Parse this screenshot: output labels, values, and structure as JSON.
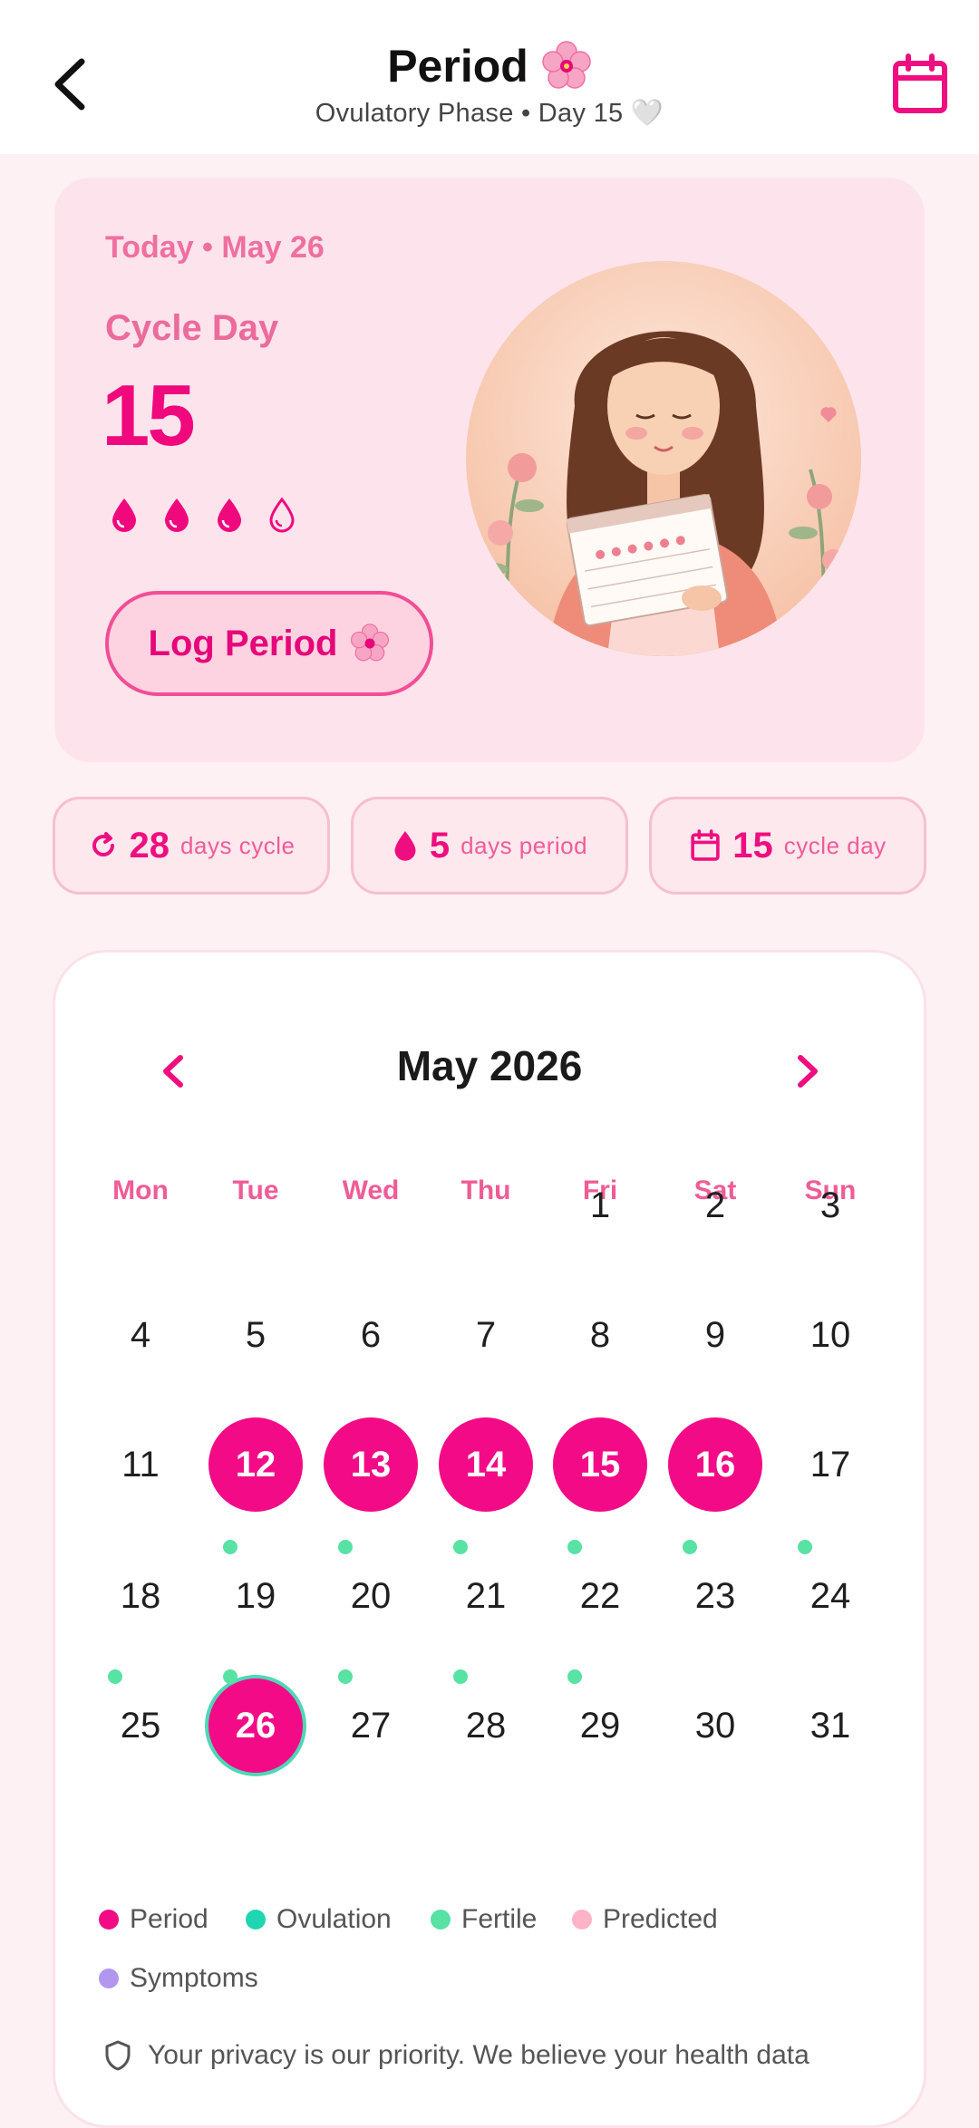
{
  "header": {
    "title": "Period",
    "subtitle": "Ovulatory Phase • Day 15 🤍",
    "back_icon": "chevron-left-icon",
    "calendar_icon": "calendar-icon"
  },
  "hero": {
    "date": "Today • May 26",
    "cycle_label": "Cycle Day",
    "cycle_day": "15",
    "flow_level": "3 of 4",
    "log_button": "Log Period"
  },
  "stats": [
    {
      "icon": "refresh-icon",
      "value": "28",
      "label": "days cycle"
    },
    {
      "icon": "drop-icon",
      "value": "5",
      "label": "days period"
    },
    {
      "icon": "calendar-icon",
      "value": "15",
      "label": "cycle day"
    }
  ],
  "calendar": {
    "month": "May 2026",
    "weekdays": [
      "Mon",
      "Tue",
      "Wed",
      "Thu",
      "Fri",
      "Sat",
      "Sun"
    ],
    "weeks": [
      [
        "",
        "",
        "",
        "",
        "1",
        "2",
        "3"
      ],
      [
        "4",
        "5",
        "6",
        "7",
        "8",
        "9",
        "10"
      ],
      [
        "11",
        "12",
        "13",
        "14",
        "15",
        "16",
        "17"
      ],
      [
        "18",
        "19",
        "20",
        "21",
        "22",
        "23",
        "24"
      ],
      [
        "25",
        "26",
        "27",
        "28",
        "29",
        "30",
        "31"
      ]
    ],
    "period_days": [
      "12",
      "13",
      "14",
      "15",
      "16"
    ],
    "today": "26",
    "fertile_days": [
      "19",
      "20",
      "21",
      "22",
      "23",
      "24",
      "25",
      "26",
      "27",
      "28",
      "29"
    ]
  },
  "legend": [
    {
      "label": "Period",
      "color": "#f30a86"
    },
    {
      "label": "Ovulation",
      "color": "#1fd6b0"
    },
    {
      "label": "Fertile",
      "color": "#58e2a4"
    },
    {
      "label": "Predicted",
      "color": "#ffb3c9"
    },
    {
      "label": "Symptoms",
      "color": "#b197f0"
    }
  ],
  "privacy_text": "Your privacy is our priority. We believe your health data",
  "colors": {
    "accent": "#f30a86",
    "background": "#fdf1f3"
  }
}
